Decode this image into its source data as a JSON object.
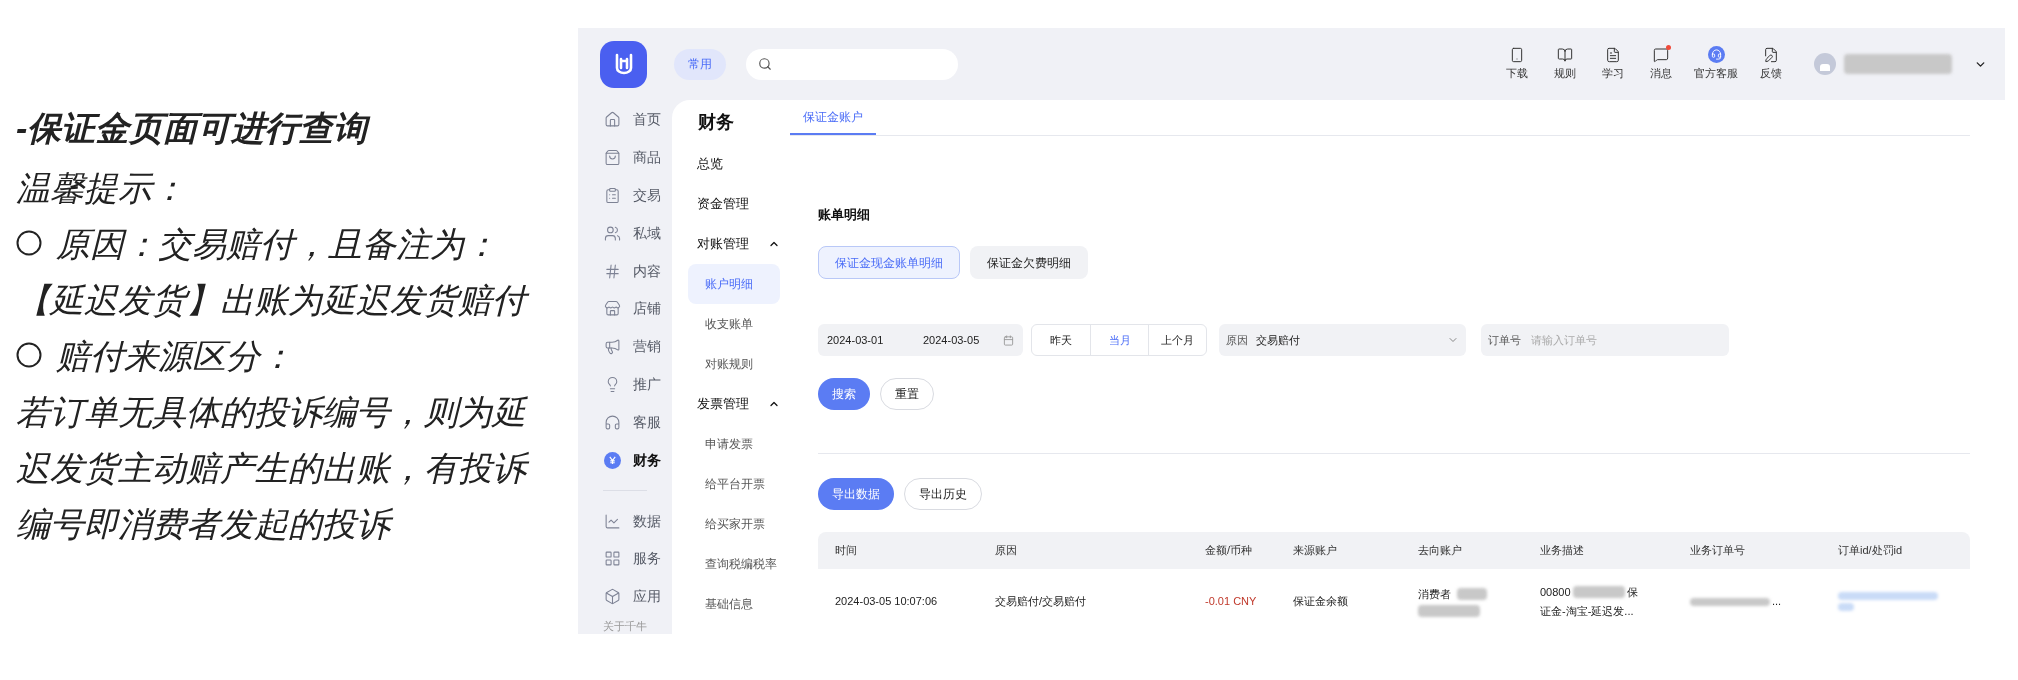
{
  "note": {
    "title": "-保证金页面可进行查询",
    "lines": [
      {
        "kind": "plain",
        "text": "温馨提示："
      },
      {
        "kind": "bullet",
        "text": "原因：交易赔付，且备注为："
      },
      {
        "kind": "plain",
        "text": "【延迟发货】出账为延迟发货赔付"
      },
      {
        "kind": "bullet",
        "text": "赔付来源区分："
      },
      {
        "kind": "plain",
        "text": "若订单无具体的投诉编号，则为延迟发货主动赔产生的出账，有投诉编号即消费者发起的投诉"
      }
    ]
  },
  "topbar": {
    "pinned": "常用",
    "nav": [
      {
        "label": "下载",
        "badge": false
      },
      {
        "label": "规则",
        "badge": false
      },
      {
        "label": "学习",
        "badge": false
      },
      {
        "label": "消息",
        "badge": true
      },
      {
        "label": "官方客服",
        "badge": false
      },
      {
        "label": "反馈",
        "badge": false
      }
    ]
  },
  "sidebar": {
    "items": [
      {
        "label": "首页",
        "selected": false
      },
      {
        "label": "商品",
        "selected": false
      },
      {
        "label": "交易",
        "selected": false
      },
      {
        "label": "私域",
        "selected": false
      },
      {
        "label": "内容",
        "selected": false
      },
      {
        "label": "店铺",
        "selected": false
      },
      {
        "label": "营销",
        "selected": false
      },
      {
        "label": "推广",
        "selected": false
      },
      {
        "label": "客服",
        "selected": false
      },
      {
        "label": "财务",
        "selected": true
      }
    ],
    "more_items": [
      {
        "label": "数据",
        "selected": false
      },
      {
        "label": "服务",
        "selected": false
      },
      {
        "label": "应用",
        "selected": false
      }
    ],
    "footer": "关于千牛"
  },
  "subnav": {
    "title": "财务",
    "items": [
      {
        "label": "总览",
        "selected": false
      },
      {
        "label": "资金管理",
        "selected": false
      },
      {
        "label": "对账管理",
        "expanded": true,
        "children": [
          {
            "label": "账户明细",
            "selected": true
          },
          {
            "label": "收支账单",
            "selected": false
          },
          {
            "label": "对账规则",
            "selected": false
          }
        ]
      },
      {
        "label": "发票管理",
        "expanded": true,
        "children": [
          {
            "label": "申请发票",
            "selected": false
          },
          {
            "label": "给平台开票",
            "selected": false
          },
          {
            "label": "给买家开票",
            "selected": false
          },
          {
            "label": "查询税编税率",
            "selected": false
          },
          {
            "label": "基础信息",
            "selected": false
          }
        ]
      }
    ]
  },
  "tabs": [
    {
      "label": "保证金账户",
      "selected": true
    }
  ],
  "section_title": "账单明细",
  "subtabs": [
    {
      "label": "保证金现金账单明细",
      "selected": true
    },
    {
      "label": "保证金欠费明细",
      "selected": false
    }
  ],
  "filters": {
    "date_start": "2024-03-01",
    "date_end": "2024-03-05",
    "quick_ranges": [
      {
        "label": "昨天",
        "selected": false
      },
      {
        "label": "当月",
        "selected": true
      },
      {
        "label": "上个月",
        "selected": false
      }
    ],
    "reason": {
      "label": "原因",
      "value": "交易赔付"
    },
    "order": {
      "label": "订单号",
      "placeholder": "请输入订单号"
    }
  },
  "actions": [
    {
      "label": "搜索",
      "kind": "primary"
    },
    {
      "label": "重置",
      "kind": "secondary"
    }
  ],
  "export_actions": [
    {
      "label": "导出数据",
      "kind": "primary"
    },
    {
      "label": "导出历史",
      "kind": "secondary"
    }
  ],
  "table": {
    "columns": [
      "时间",
      "原因",
      "金额/币种",
      "来源账户",
      "去向账户",
      "业务描述",
      "业务订单号",
      "订单id/处罚id"
    ],
    "rows": [
      {
        "time": "2024-03-05 10:07:06",
        "reason": "交易赔付/交易赔付",
        "amount": "-0.01 CNY",
        "source": "保证金余额",
        "destination": "消费者",
        "description_start": "00800",
        "description_end": "保",
        "description_line2": "证金-淘宝-延迟发...",
        "business_order": "..."
      }
    ]
  }
}
